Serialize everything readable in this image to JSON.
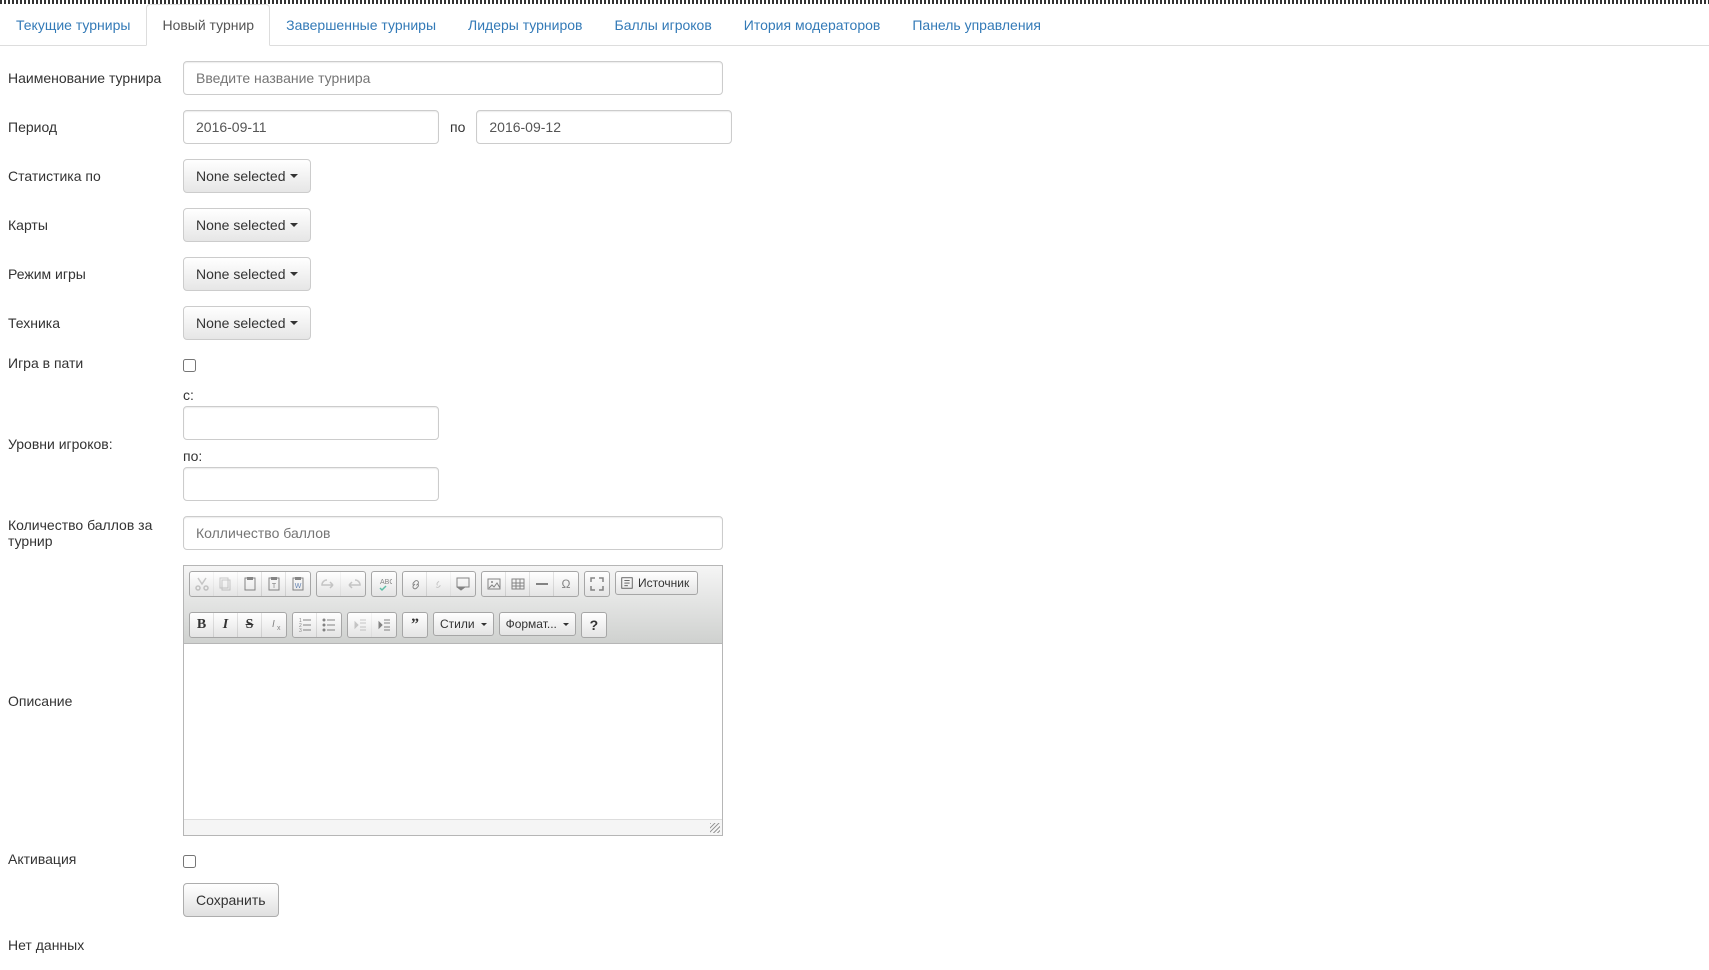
{
  "tabs": [
    {
      "label": "Текущие турниры",
      "active": false
    },
    {
      "label": "Новый турнир",
      "active": true
    },
    {
      "label": "Завершенные турниры",
      "active": false
    },
    {
      "label": "Лидеры турниров",
      "active": false
    },
    {
      "label": "Баллы игроков",
      "active": false
    },
    {
      "label": "Итория модераторов",
      "active": false
    },
    {
      "label": "Панель управления",
      "active": false
    }
  ],
  "form": {
    "name_label": "Наименование турнира",
    "name_placeholder": "Введите название турнира",
    "period_label": "Период",
    "period_from": "2016-09-11",
    "period_to_label": "по",
    "period_to": "2016-09-12",
    "stats_label": "Статистика по",
    "maps_label": "Карты",
    "mode_label": "Режим игры",
    "tech_label": "Техника",
    "dropdown_default": "None selected",
    "party_label": "Игра в пати",
    "levels_label": "Уровни игроков:",
    "levels_from_label": "с:",
    "levels_to_label": "по:",
    "points_label": "Количество баллов за турнир",
    "points_placeholder": "Колличество баллов",
    "description_label": "Описание",
    "activation_label": "Активация",
    "save_label": "Сохранить"
  },
  "editor": {
    "styles_label": "Стили",
    "format_label": "Формат...",
    "source_label": "Источник"
  },
  "footer": {
    "no_data": "Нет данных"
  }
}
